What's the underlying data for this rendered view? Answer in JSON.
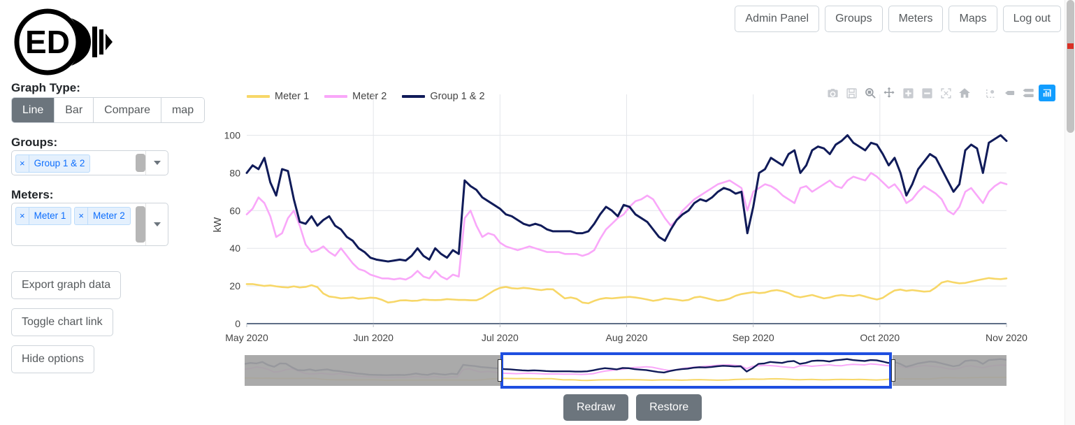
{
  "app": {
    "logo_text": "ED",
    "logo_alt": "ed-lightbulb-logo"
  },
  "topnav": {
    "items": [
      {
        "label": "Admin Panel",
        "name": "admin-panel"
      },
      {
        "label": "Groups",
        "name": "groups"
      },
      {
        "label": "Meters",
        "name": "meters"
      },
      {
        "label": "Maps",
        "name": "maps"
      },
      {
        "label": "Log out",
        "name": "log-out"
      }
    ]
  },
  "sidebar": {
    "graph_type_label": "Graph Type:",
    "graph_types": [
      {
        "label": "Line",
        "active": true
      },
      {
        "label": "Bar",
        "active": false
      },
      {
        "label": "Compare",
        "active": false
      },
      {
        "label": "map",
        "active": false
      }
    ],
    "groups_label": "Groups:",
    "groups_selected": [
      {
        "label": "Group 1 & 2",
        "remove": "×"
      }
    ],
    "meters_label": "Meters:",
    "meters_selected": [
      {
        "label": "Meter 1",
        "remove": "×"
      },
      {
        "label": "Meter 2",
        "remove": "×"
      }
    ],
    "buttons": [
      {
        "label": "Export graph data",
        "name": "export-graph-data"
      },
      {
        "label": "Toggle chart link",
        "name": "toggle-chart-link"
      },
      {
        "label": "Hide options",
        "name": "hide-options"
      }
    ]
  },
  "modebar": {
    "items": [
      {
        "name": "download-camera-icon",
        "title": "Download plot as a png"
      },
      {
        "name": "save-disk-icon",
        "title": "Edit in Chart Studio"
      },
      {
        "name": "zoom-magnifier-icon",
        "title": "Zoom"
      },
      {
        "name": "pan-move-icon",
        "title": "Pan"
      },
      {
        "name": "zoom-in-icon",
        "title": "Zoom in"
      },
      {
        "name": "zoom-out-icon",
        "title": "Zoom out"
      },
      {
        "name": "autoscale-icon",
        "title": "Autoscale"
      },
      {
        "name": "reset-home-icon",
        "title": "Reset axes"
      },
      {
        "name": "spike-lines-icon",
        "title": "Toggle Spike Lines"
      },
      {
        "name": "hover-closest-icon",
        "title": "Show closest data on hover"
      },
      {
        "name": "hover-compare-icon",
        "title": "Compare data on hover"
      },
      {
        "name": "plotly-logo-icon",
        "title": "Produced with Plotly"
      }
    ]
  },
  "rangeslider": {
    "name": "range-slider",
    "selection_start_pct": 33.6,
    "selection_end_pct": 85.0
  },
  "bottom_buttons": [
    {
      "label": "Redraw",
      "name": "redraw-button"
    },
    {
      "label": "Restore",
      "name": "restore-button"
    }
  ],
  "chart_data": {
    "type": "line",
    "title": "",
    "xlabel": "",
    "ylabel": "kW",
    "ylim": [
      0,
      105
    ],
    "yticks": [
      0,
      20,
      40,
      60,
      80,
      100
    ],
    "xticks": [
      "May 2020",
      "Jun 2020",
      "Jul 2020",
      "Aug 2020",
      "Sep 2020",
      "Oct 2020",
      "Nov 2020"
    ],
    "grid": true,
    "legend_position": "top-left",
    "colors": {
      "meter_1": "#f7d768",
      "meter_2": "#f9a7f9",
      "group_1_2": "#101b59"
    },
    "series": [
      {
        "name": "Meter 1",
        "color": "#f7d768",
        "values": [
          21,
          21,
          20.5,
          20,
          20.3,
          19.8,
          19.4,
          19.2,
          19.8,
          19.2,
          19.5,
          20.4,
          19.4,
          16,
          14.4,
          14,
          13.4,
          13.6,
          13.9,
          13.2,
          13.4,
          13.8,
          13.6,
          12.6,
          11.2,
          11.6,
          12.3,
          12.4,
          12.1,
          12.2,
          12.8,
          12.6,
          12.5,
          12.6,
          13,
          12.8,
          12.6,
          12.6,
          12.4,
          12.4,
          13.6,
          15.6,
          17.6,
          19,
          19.5,
          18.8,
          18.6,
          19,
          18.7,
          18.2,
          17.8,
          18.3,
          18.2,
          15.8,
          13.4,
          13.9,
          13.2,
          11.2,
          10.8,
          12.1,
          13.1,
          13.6,
          13.4,
          13.7,
          14,
          14.2,
          13.9,
          13.4,
          12.8,
          12.1,
          12.6,
          13.4,
          13.1,
          12.7,
          12.2,
          12.6,
          13.9,
          14.3,
          13.6,
          12.8,
          12.1,
          12.5,
          13.3,
          14.8,
          15.7,
          16.2,
          16.7,
          16.2,
          16.5,
          17.4,
          17.8,
          17.2,
          16.2,
          14.6,
          14,
          14.6,
          15.2,
          14.3,
          13.4,
          13.9,
          14.8,
          15.2,
          14.8,
          14.6,
          15.2,
          14.4,
          13.5,
          12.8,
          13.7,
          15.8,
          17.6,
          18.1,
          17.4,
          17.8,
          17.4,
          17,
          17.2,
          19.2,
          21.8,
          22.6,
          21.9,
          21.4,
          21.6,
          22.3,
          23,
          23.6,
          24.2,
          23.8,
          23.6,
          24
        ]
      },
      {
        "name": "Meter 2",
        "color": "#f9a7f9",
        "values": [
          58,
          61,
          67,
          64,
          57,
          46,
          48,
          56,
          60,
          52,
          42,
          38,
          39,
          41,
          38,
          36,
          40,
          36,
          32,
          29,
          28,
          26,
          25,
          24,
          24,
          23.5,
          24,
          23.4,
          25,
          28,
          25,
          24,
          28,
          25,
          23.5,
          26,
          25,
          56,
          60,
          52,
          46,
          48,
          47,
          43,
          41,
          40,
          39,
          40,
          41,
          40,
          39,
          38,
          38,
          38,
          37,
          37,
          37,
          36,
          37,
          39,
          45,
          50,
          53,
          56,
          58,
          62,
          65,
          66,
          68,
          66,
          61,
          56,
          52,
          55,
          60,
          63,
          66,
          68,
          70,
          72,
          74,
          75,
          76,
          74,
          72,
          60,
          70,
          72,
          74,
          73,
          71,
          68,
          66,
          64,
          72,
          73,
          70,
          72,
          74,
          76,
          73,
          72,
          76,
          78,
          77,
          76,
          80,
          78,
          75,
          72,
          74,
          70,
          64,
          66,
          70,
          73,
          71,
          69,
          66,
          60,
          58,
          62,
          70,
          72,
          68,
          64,
          70,
          73,
          75,
          74
        ]
      },
      {
        "name": "Group 1 & 2",
        "color": "#101b59",
        "values": [
          80,
          84,
          82,
          88,
          75,
          68,
          82,
          81,
          66,
          54,
          53,
          57,
          52,
          55,
          57,
          52,
          50,
          46,
          44,
          40,
          38,
          35,
          34,
          33.5,
          33,
          33.5,
          34,
          33.5,
          36,
          40,
          36,
          34,
          40,
          37,
          35,
          39,
          37,
          76,
          73,
          71,
          67,
          65,
          63,
          61,
          58,
          57,
          55,
          53,
          52,
          53,
          52,
          50,
          49,
          49,
          49,
          49,
          48,
          48,
          49,
          53,
          58,
          62,
          60,
          57,
          63,
          62,
          58,
          56,
          54,
          50,
          46,
          44,
          50,
          55,
          58,
          60,
          64,
          66,
          65,
          67,
          70,
          72,
          71,
          69,
          70,
          48,
          62,
          80,
          82,
          88,
          86,
          84,
          90,
          92,
          80,
          84,
          92,
          94,
          93,
          90,
          95,
          97,
          100,
          96,
          94,
          92,
          96,
          95,
          90,
          84,
          88,
          80,
          68,
          74,
          82,
          86,
          90,
          88,
          82,
          76,
          70,
          74,
          92,
          95,
          93,
          80,
          96,
          98,
          100,
          97
        ]
      }
    ]
  }
}
